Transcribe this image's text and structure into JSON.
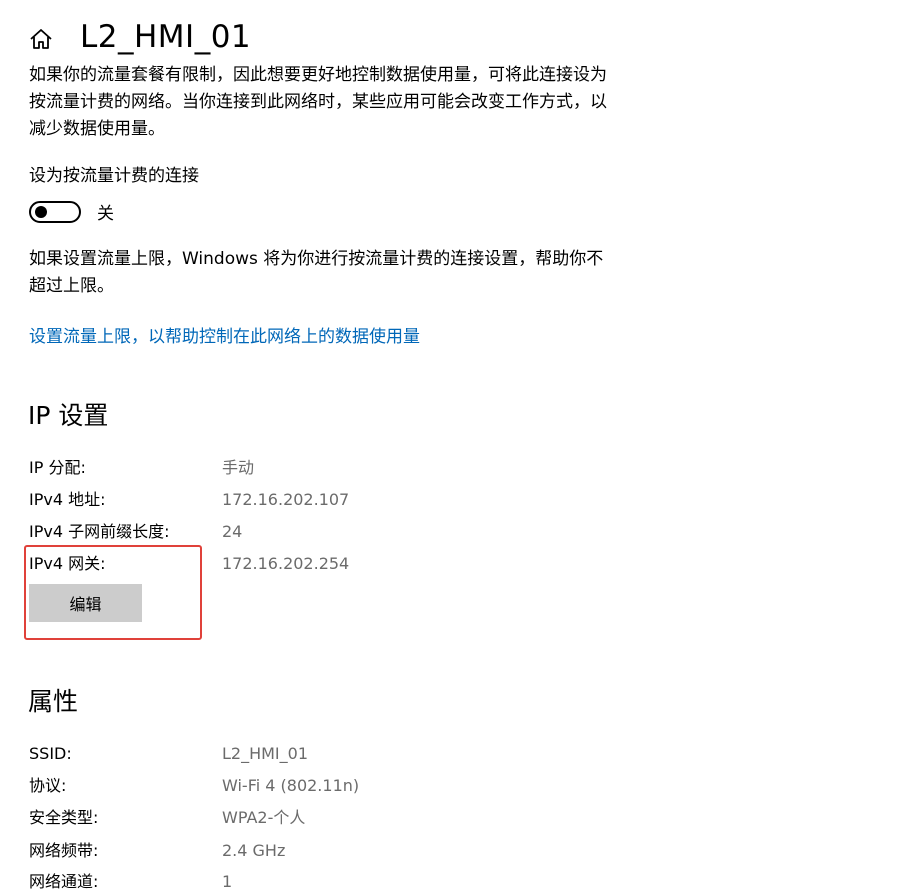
{
  "header": {
    "title": "L2_HMI_01",
    "home_icon": "home-icon"
  },
  "metered": {
    "description": "如果你的流量套餐有限制，因此想要更好地控制数据使用量，可将此连接设为按流量计费的网络。当你连接到此网络时，某些应用可能会改变工作方式，以减少数据使用量。",
    "setting_label": "设为按流量计费的连接",
    "toggle_state": "关",
    "toggle_on": false,
    "limit_description": "如果设置流量上限，Windows 将为你进行按流量计费的连接设置，帮助你不超过上限。",
    "limit_link": "设置流量上限，以帮助控制在此网络上的数据使用量",
    "link_color": "#0067b8"
  },
  "ip_settings": {
    "title": "IP 设置",
    "rows": [
      {
        "key": "IP 分配:",
        "value": "手动"
      },
      {
        "key": "IPv4 地址:",
        "value": "172.16.202.107"
      },
      {
        "key": "IPv4 子网前缀长度:",
        "value": "24"
      },
      {
        "key": "IPv4 网关:",
        "value": "172.16.202.254"
      }
    ],
    "edit_label": "编辑",
    "highlight_color": "#e0413a"
  },
  "properties": {
    "title": "属性",
    "rows": [
      {
        "key": "SSID:",
        "value": "L2_HMI_01"
      },
      {
        "key": "协议:",
        "value": "Wi-Fi 4 (802.11n)"
      },
      {
        "key": "安全类型:",
        "value": "WPA2-个人"
      },
      {
        "key": "网络频带:",
        "value": "2.4 GHz"
      },
      {
        "key": "网络通道:",
        "value": "1"
      }
    ]
  }
}
